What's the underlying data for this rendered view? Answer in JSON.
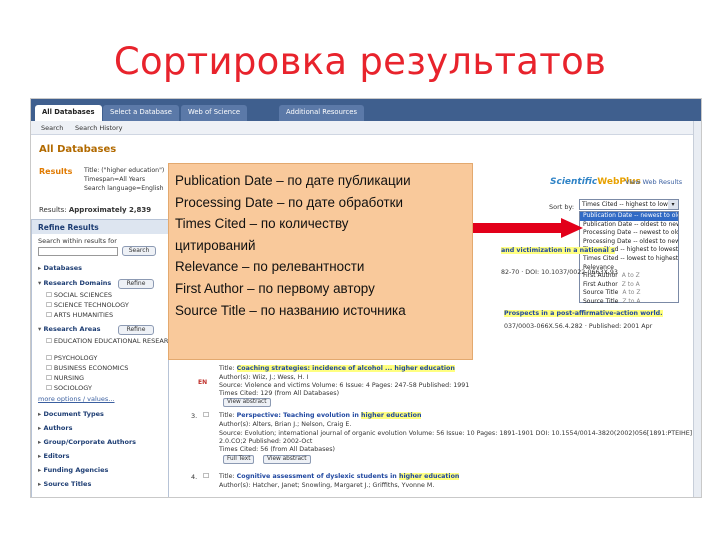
{
  "slide": {
    "title": "Сортировка результатов"
  },
  "screenshot": {
    "tabs": [
      "All Databases",
      "Select a Database",
      "Web of Science",
      "Additional Resources"
    ],
    "subnav": [
      "Search",
      "Search History"
    ],
    "database_title": "All Databases",
    "results_label": "Results",
    "query": {
      "line1": "Title: (\"higher education\")",
      "line2": "Timespan=All Years",
      "line3": "Search language=English"
    },
    "logo": {
      "part1": "Scientific",
      "part2": "WebPlus"
    },
    "logo_link": "View Web Results",
    "results_count_label": "Results:",
    "results_count_value": "Approximately 2,839",
    "sort_label": "Sort by:",
    "sort_selected": "Times Cited -- highest to lowest",
    "sort_options": [
      {
        "label": "Publication Date -- newest to oldest",
        "selected": true
      },
      {
        "label": "Publication Date -- oldest to newest",
        "selected": false
      },
      {
        "label": "Processing Date -- newest to oldest",
        "selected": false
      },
      {
        "label": "Processing Date -- oldest to newest",
        "selected": false
      },
      {
        "label": "Times Cited -- highest to lowest",
        "selected": false
      },
      {
        "label": "Times Cited -- lowest to highest",
        "selected": false
      },
      {
        "label": "Relevance",
        "selected": false
      },
      {
        "label": "First Author",
        "sub": "A to Z",
        "selected": false
      },
      {
        "label": "First Author",
        "sub": "Z to A",
        "selected": false
      },
      {
        "label": "Source Title",
        "sub": "A to Z",
        "selected": false
      },
      {
        "label": "Source Title",
        "sub": "Z to A",
        "selected": false
      }
    ],
    "refine": {
      "header": "Refine Results",
      "search_label": "Search within results for",
      "search_button": "Search",
      "refine_button": "Refine",
      "databases": "Databases",
      "research_domains": "Research Domains",
      "domain_items": [
        "SOCIAL SCIENCES",
        "SCIENCE TECHNOLOGY",
        "ARTS HUMANITIES"
      ],
      "research_areas": "Research Areas",
      "area_items": [
        "EDUCATION EDUCATIONAL RESEARCH",
        "PSYCHOLOGY",
        "BUSINESS ECONOMICS",
        "NURSING",
        "SOCIOLOGY"
      ],
      "more_options": "more options / values...",
      "document_types": "Document Types",
      "authors": "Authors",
      "group_authors": "Group/Corporate Authors",
      "editors": "Editors",
      "funding": "Funding Agencies",
      "source_titles": "Source Titles"
    },
    "records": {
      "r1_title": "and victimization in a national s",
      "r1_meta": "82-70 · DOI: 10.1037/0022-0663X.93",
      "r2_title": "Prospects in a post-affirmative-action world.",
      "r2_meta": "037/0003-066X.56.4.282 · Published: 2001 Apr",
      "r3_prefix": "Title:",
      "r3_title": "Coaching strategies: incidence of alcohol ... higher education",
      "r3_authors": "Author(s): Wiiz, J.; Wess, H. I",
      "r3_source": "Source: Violence and victims  Volume: 6  Issue: 4  Pages: 247-58  Published: 1991",
      "r3_cited": "Times Cited: 129  (from All Databases)",
      "r3_view": "View abstract",
      "r4_num": "3.",
      "r4_prefix": "Title:",
      "r4_title": "Perspective: Teaching evolution in ",
      "r4_title_hl": "higher education",
      "r4_authors": "Author(s): Alters, Brian J.; Nelson, Craig E.",
      "r4_source": "Source: Evolution; international journal of organic evolution  Volume: 56  Issue: 10  Pages: 1891-1901  DOI: 10.1554/0014-3820(2002)056[1891:PTEIHE]",
      "r4_date": "2.0.CO;2  Published: 2002-Oct",
      "r4_cited": "Times Cited: 56  (from All Databases)",
      "r4_fulltext": "Full Text",
      "r4_view": "View abstract",
      "r5_num": "4.",
      "r5_prefix": "Title:",
      "r5_title": "Cognitive assessment of dyslexic students in ",
      "r5_title_hl": "higher education",
      "r5_authors": "Author(s): Hatcher, Janet; Snowling, Margaret J.; Griffiths, Yvonne M."
    },
    "badge": "EN"
  },
  "callout": {
    "lines": [
      "Publication Date – по дате публикации",
      "Processing Date – по дате обработки",
      "Times Cited – по количеству",
      "цитирований",
      "Relevance – по релевантности",
      "First Author – по первому автору",
      "Source Title – по названию источника"
    ]
  },
  "colors": {
    "title_red": "#e8232c",
    "callout_bg": "#f9c99b",
    "arrow_red": "#e2001a",
    "tab_bar": "#3f5f8e"
  }
}
